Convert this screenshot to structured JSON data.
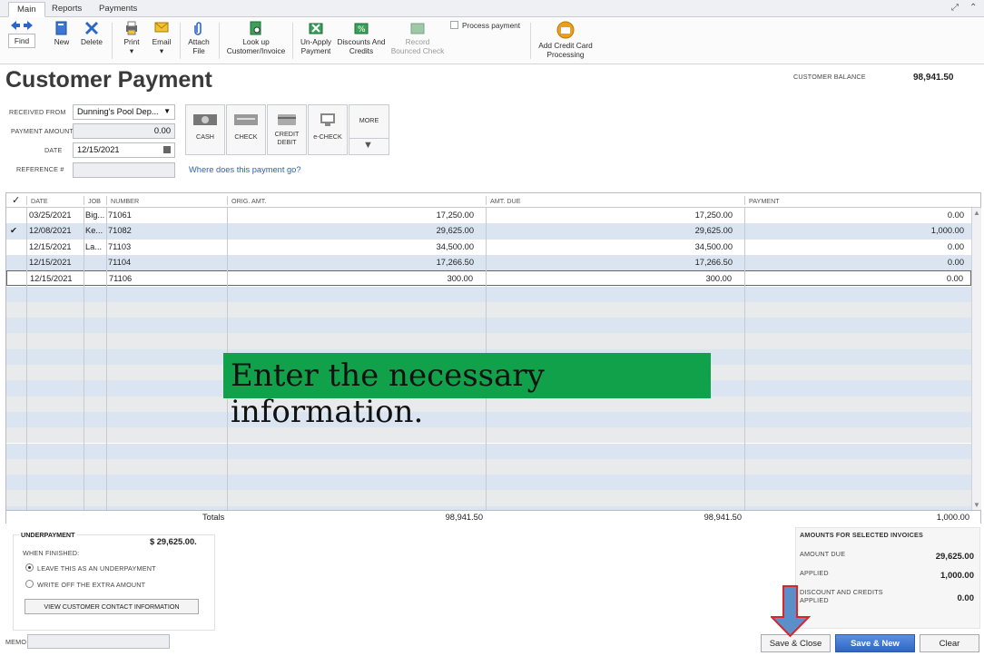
{
  "tabs": [
    "Main",
    "Reports",
    "Payments"
  ],
  "toolbar": {
    "find": "Find",
    "new": "New",
    "delete": "Delete",
    "print": "Print",
    "email": "Email",
    "attach_1": "Attach",
    "attach_2": "File",
    "lookup_1": "Look up",
    "lookup_2": "Customer/Invoice",
    "unapply_1": "Un-Apply",
    "unapply_2": "Payment",
    "discounts_1": "Discounts And",
    "discounts_2": "Credits",
    "record_1": "Record",
    "record_2": "Bounced Check",
    "process_payment": "Process payment",
    "addcc_1": "Add Credit Card",
    "addcc_2": "Processing"
  },
  "header": {
    "title": "Customer Payment",
    "customer_balance_label": "CUSTOMER BALANCE",
    "customer_balance": "98,941.50"
  },
  "form": {
    "received_from_label": "RECEIVED FROM",
    "received_from": "Dunning's Pool Dep...",
    "payment_amount_label": "PAYMENT AMOUNT",
    "payment_amount": "0.00",
    "date_label": "DATE",
    "date": "12/15/2021",
    "reference_label": "REFERENCE #",
    "reference": ""
  },
  "payment_methods": [
    "CASH",
    "CHECK",
    "CREDIT\nDEBIT",
    "e-CHECK",
    "MORE"
  ],
  "where_link": "Where does this payment go?",
  "grid": {
    "headers": [
      "DATE",
      "JOB",
      "NUMBER",
      "ORIG. AMT.",
      "AMT. DUE",
      "PAYMENT"
    ],
    "rows": [
      {
        "check": "",
        "date": "03/25/2021",
        "job": "Big...",
        "number": "71061",
        "orig": "17,250.00",
        "due": "17,250.00",
        "payment": "0.00"
      },
      {
        "check": "✔",
        "date": "12/08/2021",
        "job": "Ke...",
        "number": "71082",
        "orig": "29,625.00",
        "due": "29,625.00",
        "payment": "1,000.00"
      },
      {
        "check": "",
        "date": "12/15/2021",
        "job": "La...",
        "number": "71103",
        "orig": "34,500.00",
        "due": "34,500.00",
        "payment": "0.00"
      },
      {
        "check": "",
        "date": "12/15/2021",
        "job": "",
        "number": "71104",
        "orig": "17,266.50",
        "due": "17,266.50",
        "payment": "0.00"
      },
      {
        "check": "",
        "date": "12/15/2021",
        "job": "",
        "number": "71106",
        "orig": "300.00",
        "due": "300.00",
        "payment": "0.00"
      }
    ],
    "totals_label": "Totals",
    "total_orig": "98,941.50",
    "total_due": "98,941.50",
    "total_payment": "1,000.00"
  },
  "underpayment": {
    "title": "UNDERPAYMENT",
    "amount": "$ 29,625.00.",
    "when_finished": "WHEN FINISHED:",
    "option_leave": "LEAVE THIS AS AN UNDERPAYMENT",
    "option_writeoff": "WRITE OFF THE EXTRA AMOUNT",
    "view_contact": "VIEW CUSTOMER CONTACT INFORMATION"
  },
  "amounts": {
    "title": "AMOUNTS FOR SELECTED INVOICES",
    "amount_due_label": "AMOUNT DUE",
    "amount_due": "29,625.00",
    "applied_label": "APPLIED",
    "applied": "1,000.00",
    "discount_label_1": "DISCOUNT AND CREDITS",
    "discount_label_2": "APPLIED",
    "discount": "0.00"
  },
  "memo_label": "MEMO",
  "buttons": {
    "save_close": "Save & Close",
    "save_new": "Save & New",
    "clear": "Clear"
  },
  "overlay_text": "Enter the necessary information.",
  "colors": {
    "overlay": "#12a14b",
    "stripe_blue": "#dbe5f1",
    "stripe_gray": "#e9eaec",
    "arrow": "#d9262a"
  }
}
